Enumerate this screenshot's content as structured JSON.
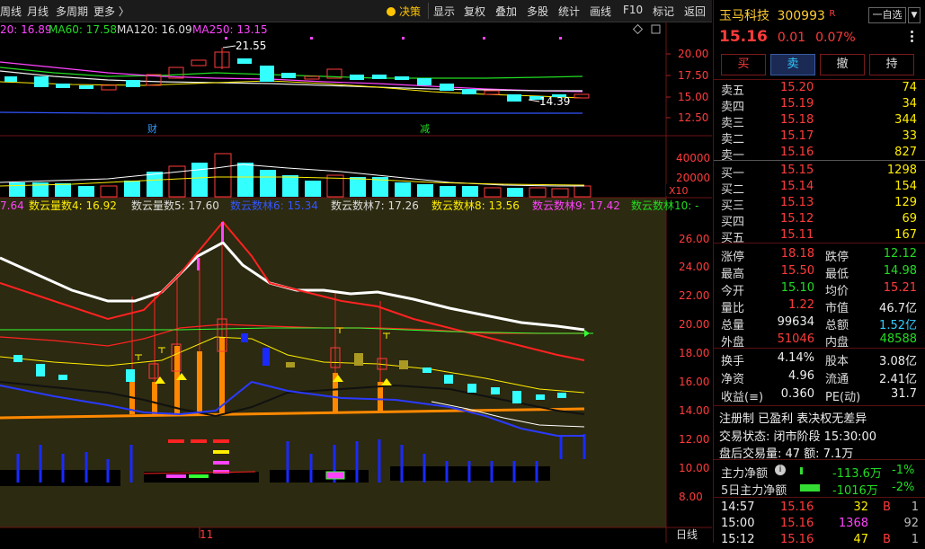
{
  "toolbar": {
    "left_items": [
      "周线",
      "月线",
      "多周期",
      "更多 〉"
    ],
    "decision": "决策",
    "right_items": [
      "显示",
      "复权",
      "叠加",
      "多股",
      "统计",
      "画线",
      "F10",
      "标记",
      "返回"
    ]
  },
  "ma_legend": [
    {
      "text": "20: 16.89",
      "color": "#ff44ff"
    },
    {
      "text": "MA60: 17.58",
      "color": "#22dd22"
    },
    {
      "text": "MA120: 16.09",
      "color": "#dddddd"
    },
    {
      "text": "MA250: 13.15",
      "color": "#ff44ff"
    }
  ],
  "price_axis": [
    "20.00",
    "17.50",
    "15.00",
    "12.50"
  ],
  "price_annotations": {
    "high": "21.55",
    "low": "14.39"
  },
  "event_labels": {
    "cai": "财",
    "jian": "减"
  },
  "volume_axis": [
    "40000",
    "20000"
  ],
  "volume_unit": "X10",
  "cloud_legend": [
    {
      "text": "7.64",
      "color": "#ff44ff"
    },
    {
      "text": "数云量数4: 16.92",
      "color": "#ffee00"
    },
    {
      "text": "数云量数5: 17.60",
      "color": "#dddddd"
    },
    {
      "text": "数云数林6: 15.34",
      "color": "#3355ff"
    },
    {
      "text": "数云数林7: 17.26",
      "color": "#dddddd"
    },
    {
      "text": "数云数林8: 13.56",
      "color": "#ffee00"
    },
    {
      "text": "数云数林9: 17.42",
      "color": "#ff44ff"
    },
    {
      "text": "数云数林10: -",
      "color": "#22dd22"
    }
  ],
  "indicator_axis": [
    "26.00",
    "24.00",
    "22.00",
    "20.00",
    "18.00",
    "16.00",
    "14.00",
    "12.00",
    "10.00",
    "8.00"
  ],
  "month_marker": "11",
  "period_label": "日线",
  "stock": {
    "name": "玉马科技",
    "code": "300993",
    "badge": "R",
    "watch_button": "一自选",
    "price": "15.16",
    "change": "0.01",
    "change_pct": "0.07%"
  },
  "trade_buttons": [
    "买",
    "卖",
    "撤",
    "持"
  ],
  "asks": [
    {
      "label": "卖五",
      "price": "15.20",
      "vol": "74"
    },
    {
      "label": "卖四",
      "price": "15.19",
      "vol": "34"
    },
    {
      "label": "卖三",
      "price": "15.18",
      "vol": "344"
    },
    {
      "label": "卖二",
      "price": "15.17",
      "vol": "33"
    },
    {
      "label": "卖一",
      "price": "15.16",
      "vol": "827"
    }
  ],
  "bids": [
    {
      "label": "买一",
      "price": "15.15",
      "vol": "1298"
    },
    {
      "label": "买二",
      "price": "15.14",
      "vol": "154"
    },
    {
      "label": "买三",
      "price": "15.13",
      "vol": "129"
    },
    {
      "label": "买四",
      "price": "15.12",
      "vol": "69"
    },
    {
      "label": "买五",
      "price": "15.11",
      "vol": "167"
    }
  ],
  "stats1": [
    {
      "l1": "涨停",
      "v1": "18.18",
      "c1": "red",
      "l2": "跌停",
      "v2": "12.12",
      "c2": "green"
    },
    {
      "l1": "最高",
      "v1": "15.50",
      "c1": "red",
      "l2": "最低",
      "v2": "14.98",
      "c2": "green"
    },
    {
      "l1": "今开",
      "v1": "15.10",
      "c1": "green",
      "l2": "均价",
      "v2": "15.21",
      "c2": "red"
    },
    {
      "l1": "量比",
      "v1": "1.22",
      "c1": "red",
      "l2": "市值",
      "v2": "46.7亿",
      "c2": "white"
    },
    {
      "l1": "总量",
      "v1": "99634",
      "c1": "white",
      "l2": "总额",
      "v2": "1.52亿",
      "c2": "cyan"
    },
    {
      "l1": "外盘",
      "v1": "51046",
      "c1": "red",
      "l2": "内盘",
      "v2": "48588",
      "c2": "green"
    }
  ],
  "stats2": [
    {
      "l1": "换手",
      "v1": "4.14%",
      "l2": "股本",
      "v2": "3.08亿"
    },
    {
      "l1": "净资",
      "v1": "4.96",
      "l2": "流通",
      "v2": "2.41亿"
    },
    {
      "l1": "收益(≡)",
      "v1": "0.360",
      "l2": "PE(动)",
      "v2": "31.7"
    }
  ],
  "info": {
    "tags": "注册制 已盈利 表决权无差异",
    "status": "交易状态: 闭市阶段 15:30:00",
    "after_hours": "盘后交易量: 47  额: 7.1万"
  },
  "flows": [
    {
      "label": "主力净额",
      "value": "-113.6万",
      "pct": "-1%"
    },
    {
      "label": "5日主力净额",
      "value": "-1016万",
      "pct": "-2%"
    }
  ],
  "ticks": [
    {
      "time": "14:57",
      "price": "15.16",
      "vol": "32",
      "vcolor": "#ffee00",
      "side": "B",
      "scolor": "#ff3b3b",
      "num": "1"
    },
    {
      "time": "15:00",
      "price": "15.16",
      "vol": "1368",
      "vcolor": "#ff44ff",
      "side": "",
      "scolor": "#ddd",
      "num": "92"
    },
    {
      "time": "15:12",
      "price": "15.16",
      "vol": "47",
      "vcolor": "#ffee00",
      "side": "B",
      "scolor": "#ff3b3b",
      "num": "1"
    }
  ]
}
